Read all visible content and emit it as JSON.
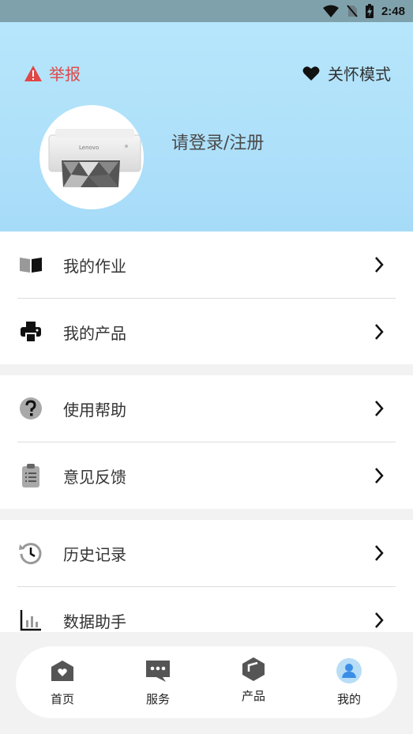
{
  "status_bar": {
    "time": "2:48"
  },
  "header": {
    "report_label": "举报",
    "care_mode_label": "关怀模式",
    "login_prompt": "请登录/注册",
    "avatar_brand": "Lenovo"
  },
  "menu": {
    "group1": [
      {
        "label": "我的作业",
        "icon": "book-icon"
      },
      {
        "label": "我的产品",
        "icon": "printer-icon"
      }
    ],
    "group2": [
      {
        "label": "使用帮助",
        "icon": "help-icon"
      },
      {
        "label": "意见反馈",
        "icon": "clipboard-icon"
      }
    ],
    "group3": [
      {
        "label": "历史记录",
        "icon": "history-icon"
      },
      {
        "label": "数据助手",
        "icon": "bar-chart-icon"
      }
    ]
  },
  "tabbar": {
    "tabs": [
      {
        "label": "首页",
        "icon": "home-icon"
      },
      {
        "label": "服务",
        "icon": "chat-icon"
      },
      {
        "label": "产品",
        "icon": "cube-icon"
      },
      {
        "label": "我的",
        "icon": "user-icon",
        "active": true
      }
    ],
    "active_color": "#3a8ee6"
  },
  "colors": {
    "header_bg": "#b0e1fa",
    "report_red": "#e04646"
  }
}
